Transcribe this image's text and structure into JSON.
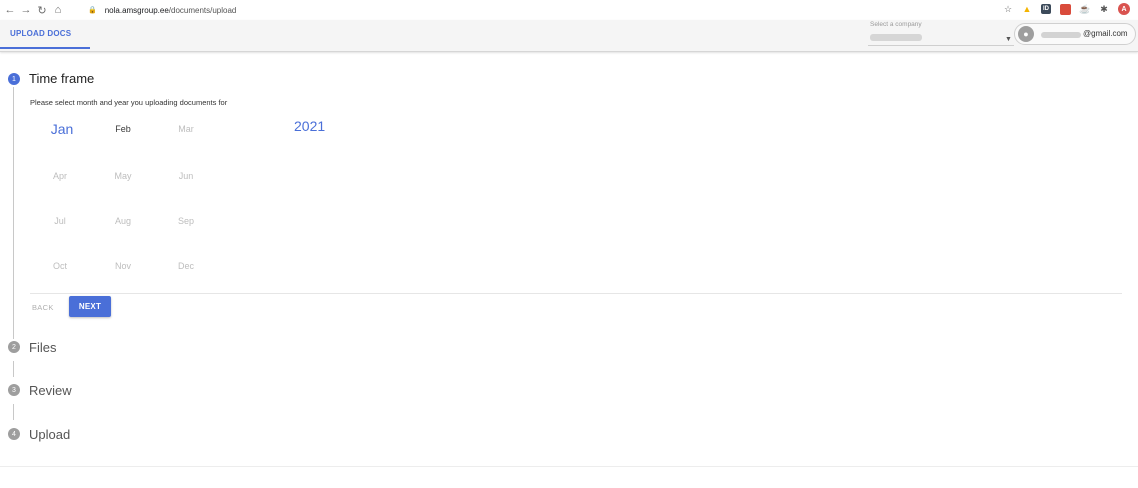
{
  "browser": {
    "back_icon": "arrow-left-icon",
    "forward_icon": "arrow-right-icon",
    "reload_icon": "reload-icon",
    "home_icon": "home-icon",
    "url_host": "nola.amsgroup.ee",
    "url_path": "/documents/upload",
    "extensions": [
      "star-icon",
      "drive-icon",
      "id-icon",
      "grid-extension-icon",
      "cup-icon",
      "puzzle-icon",
      "profile-icon"
    ],
    "profile_initial": "A"
  },
  "header": {
    "tab_label": "UPLOAD DOCS",
    "company_label": "Select a company",
    "user_email_domain": "@gmail.com"
  },
  "colors": {
    "accent": "#4a6fd8",
    "inactive": "#9e9e9e"
  },
  "stepper": {
    "steps": [
      {
        "number": "1",
        "title": "Time frame"
      },
      {
        "number": "2",
        "title": "Files"
      },
      {
        "number": "3",
        "title": "Review"
      },
      {
        "number": "4",
        "title": "Upload"
      }
    ],
    "instruction": "Please select month and year you uploading documents for",
    "months": [
      "Jan",
      "Feb",
      "Mar",
      "Apr",
      "May",
      "Jun",
      "Jul",
      "Aug",
      "Sep",
      "Oct",
      "Nov",
      "Dec"
    ],
    "selected_month": "Jan",
    "year": "2021",
    "back_label": "BACK",
    "next_label": "NEXT"
  }
}
